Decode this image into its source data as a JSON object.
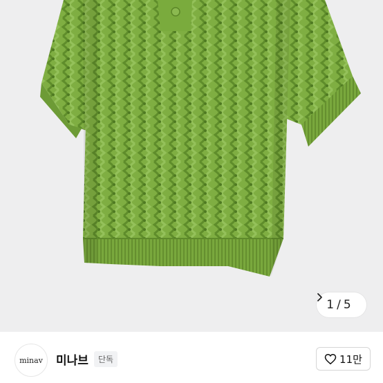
{
  "product_image": {
    "alt": "green cable-knit short sleeve polo sweater",
    "background_color": "#eeeeef",
    "garment_color": "#7aaa3e"
  },
  "gallery": {
    "current": "1",
    "separator": "/",
    "total": "5",
    "next_icon": "chevron-right-icon"
  },
  "seller": {
    "avatar_text": "minav",
    "name": "미나브",
    "badge": "단독"
  },
  "like": {
    "icon": "heart-outline-icon",
    "count": "11만"
  }
}
